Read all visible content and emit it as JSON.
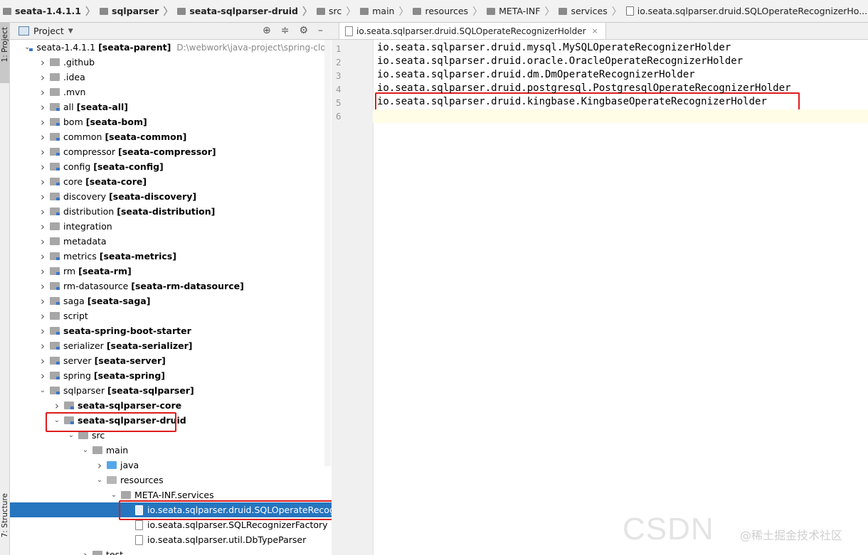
{
  "breadcrumb": [
    {
      "label": "seata-1.4.1.1",
      "bold": true,
      "icon": "folder-icon"
    },
    {
      "label": "sqlparser",
      "bold": true,
      "icon": "folder-icon"
    },
    {
      "label": "seata-sqlparser-druid",
      "bold": true,
      "icon": "folder-icon"
    },
    {
      "label": "src",
      "bold": false,
      "icon": "folder-icon"
    },
    {
      "label": "main",
      "bold": false,
      "icon": "folder-icon"
    },
    {
      "label": "resources",
      "bold": false,
      "icon": "folder-icon"
    },
    {
      "label": "META-INF",
      "bold": false,
      "icon": "folder-icon"
    },
    {
      "label": "services",
      "bold": false,
      "icon": "folder-icon"
    },
    {
      "label": "io.seata.sqlparser.druid.SQLOperateRecognizerHo...",
      "bold": false,
      "icon": "file-icon"
    }
  ],
  "sidebar_tabs": {
    "project": "1: Project",
    "structure": "7: Structure"
  },
  "project_panel": {
    "title": "Project"
  },
  "tree": [
    {
      "indent": 0,
      "arrow": "down",
      "icon": "module",
      "name": "seata-1.4.1.1",
      "module": "[seata-parent]",
      "path": "D:\\webwork\\java-project\\spring-cloud-ali"
    },
    {
      "indent": 1,
      "arrow": "right",
      "icon": "folder",
      "name": ".github"
    },
    {
      "indent": 1,
      "arrow": "right",
      "icon": "folder",
      "name": ".idea"
    },
    {
      "indent": 1,
      "arrow": "right",
      "icon": "folder",
      "name": ".mvn"
    },
    {
      "indent": 1,
      "arrow": "right",
      "icon": "module",
      "name": "all",
      "module": "[seata-all]"
    },
    {
      "indent": 1,
      "arrow": "right",
      "icon": "module",
      "name": "bom",
      "module": "[seata-bom]"
    },
    {
      "indent": 1,
      "arrow": "right",
      "icon": "module",
      "name": "common",
      "module": "[seata-common]"
    },
    {
      "indent": 1,
      "arrow": "right",
      "icon": "module",
      "name": "compressor",
      "module": "[seata-compressor]"
    },
    {
      "indent": 1,
      "arrow": "right",
      "icon": "module",
      "name": "config",
      "module": "[seata-config]"
    },
    {
      "indent": 1,
      "arrow": "right",
      "icon": "module",
      "name": "core",
      "module": "[seata-core]"
    },
    {
      "indent": 1,
      "arrow": "right",
      "icon": "module",
      "name": "discovery",
      "module": "[seata-discovery]"
    },
    {
      "indent": 1,
      "arrow": "right",
      "icon": "module",
      "name": "distribution",
      "module": "[seata-distribution]"
    },
    {
      "indent": 1,
      "arrow": "right",
      "icon": "folder",
      "name": "integration"
    },
    {
      "indent": 1,
      "arrow": "right",
      "icon": "folder",
      "name": "metadata"
    },
    {
      "indent": 1,
      "arrow": "right",
      "icon": "module",
      "name": "metrics",
      "module": "[seata-metrics]"
    },
    {
      "indent": 1,
      "arrow": "right",
      "icon": "module",
      "name": "rm",
      "module": "[seata-rm]"
    },
    {
      "indent": 1,
      "arrow": "right",
      "icon": "module",
      "name": "rm-datasource",
      "module": "[seata-rm-datasource]"
    },
    {
      "indent": 1,
      "arrow": "right",
      "icon": "module",
      "name": "saga",
      "module": "[seata-saga]"
    },
    {
      "indent": 1,
      "arrow": "right",
      "icon": "folder",
      "name": "script"
    },
    {
      "indent": 1,
      "arrow": "right",
      "icon": "module",
      "name": "seata-spring-boot-starter",
      "bold": true
    },
    {
      "indent": 1,
      "arrow": "right",
      "icon": "module",
      "name": "serializer",
      "module": "[seata-serializer]"
    },
    {
      "indent": 1,
      "arrow": "right",
      "icon": "module",
      "name": "server",
      "module": "[seata-server]"
    },
    {
      "indent": 1,
      "arrow": "right",
      "icon": "module",
      "name": "spring",
      "module": "[seata-spring]"
    },
    {
      "indent": 1,
      "arrow": "down",
      "icon": "module",
      "name": "sqlparser",
      "module": "[seata-sqlparser]"
    },
    {
      "indent": 2,
      "arrow": "right",
      "icon": "module",
      "name": "seata-sqlparser-core",
      "bold": true
    },
    {
      "indent": 2,
      "arrow": "down",
      "icon": "module",
      "name": "seata-sqlparser-druid",
      "bold": true
    },
    {
      "indent": 3,
      "arrow": "down",
      "icon": "folder",
      "name": "src"
    },
    {
      "indent": 4,
      "arrow": "down",
      "icon": "folder",
      "name": "main"
    },
    {
      "indent": 5,
      "arrow": "right",
      "icon": "blue",
      "name": "java"
    },
    {
      "indent": 5,
      "arrow": "down",
      "icon": "gray",
      "name": "resources"
    },
    {
      "indent": 6,
      "arrow": "down",
      "icon": "folder",
      "name": "META-INF.services"
    },
    {
      "indent": 7,
      "arrow": "",
      "icon": "file",
      "name": "io.seata.sqlparser.druid.SQLOperateRecognize",
      "selected": true
    },
    {
      "indent": 7,
      "arrow": "",
      "icon": "file",
      "name": "io.seata.sqlparser.SQLRecognizerFactory"
    },
    {
      "indent": 7,
      "arrow": "",
      "icon": "file",
      "name": "io.seata.sqlparser.util.DbTypeParser"
    },
    {
      "indent": 4,
      "arrow": "right",
      "icon": "folder",
      "name": "test"
    }
  ],
  "editor": {
    "tab_label": "io.seata.sqlparser.druid.SQLOperateRecognizerHolder",
    "line_numbers": [
      "1",
      "2",
      "3",
      "4",
      "5",
      "6"
    ],
    "lines": [
      "io.seata.sqlparser.druid.mysql.MySQLOperateRecognizerHolder",
      "io.seata.sqlparser.druid.oracle.OracleOperateRecognizerHolder",
      "io.seata.sqlparser.druid.dm.DmOperateRecognizerHolder",
      "io.seata.sqlparser.druid.postgresql.PostgresqlOperateRecognizerHolder",
      "io.seata.sqlparser.druid.kingbase.KingbaseOperateRecognizerHolder",
      ""
    ]
  },
  "watermark": {
    "main": "CSDN",
    "sub": "@稀土掘金技术社区"
  },
  "colors": {
    "selection": "#2675bf",
    "highlight_box": "#e01b1b",
    "current_line": "#fffde6"
  }
}
